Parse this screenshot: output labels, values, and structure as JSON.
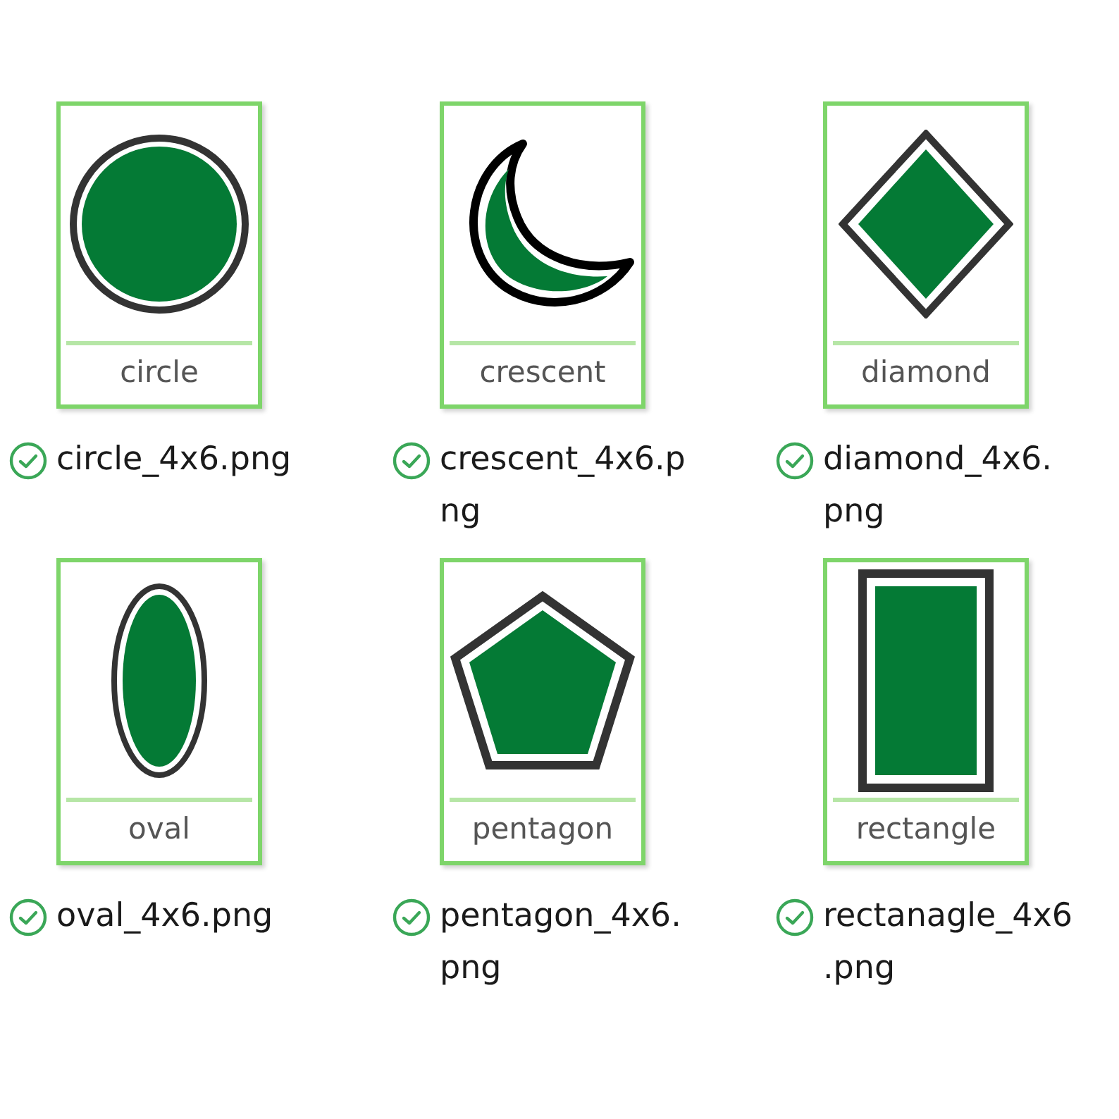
{
  "files": [
    {
      "kind": "circle",
      "thumb_label": "circle",
      "filename_lines": [
        "circle_4x6.png"
      ]
    },
    {
      "kind": "crescent",
      "thumb_label": "crescent",
      "filename_lines": [
        "crescent_4x6.p",
        "ng"
      ]
    },
    {
      "kind": "diamond",
      "thumb_label": "diamond",
      "filename_lines": [
        "diamond_4x6.",
        "png"
      ]
    },
    {
      "kind": "oval",
      "thumb_label": "oval",
      "filename_lines": [
        "oval_4x6.png"
      ]
    },
    {
      "kind": "pentagon",
      "thumb_label": "pentagon",
      "filename_lines": [
        "pentagon_4x6.",
        "png"
      ]
    },
    {
      "kind": "rectangle",
      "thumb_label": "rectangle",
      "filename_lines": [
        "rectanagle_4x6",
        ".png"
      ]
    }
  ]
}
